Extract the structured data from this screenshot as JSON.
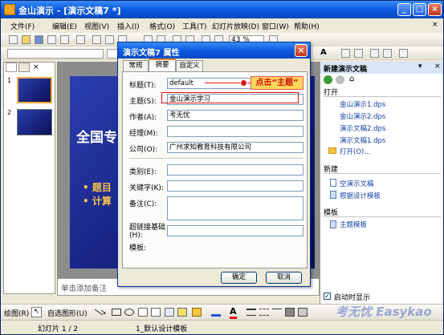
{
  "window": {
    "title": "金山演示 - [演示文稿7 *]",
    "min": "_",
    "max": "□",
    "close": "×"
  },
  "menu": [
    "文件(F)",
    "编辑(E)",
    "视图(V)",
    "插入(I)",
    "格式(O)",
    "工具(T)",
    "幻灯片放映(D)",
    "窗口(W)",
    "帮助(H)"
  ],
  "menu_extra": "×",
  "toolbar": {
    "zoom": "43 %"
  },
  "slide_pane": {
    "thumb_numbers": [
      "1",
      "2"
    ],
    "notes_placeholder": "单击添加备注"
  },
  "slide": {
    "title_partial": "全国专",
    "bullets": [
      "• 题目",
      "• 计算"
    ]
  },
  "dialog": {
    "title": "演示文稿7 属性",
    "tabs": [
      "常规",
      "摘要",
      "自定义"
    ],
    "active_tab": "摘要",
    "fields": {
      "title_label": "标题(T):",
      "title_value": "default",
      "subject_label": "主题(S):",
      "subject_value": "金山演示学习",
      "author_label": "作者(A):",
      "author_value": "考无忧",
      "manager_label": "经理(M):",
      "manager_value": "",
      "company_label": "公司(O):",
      "company_value": "广州求知教育科技有限公司",
      "category_label": "类别(E):",
      "category_value": "",
      "keywords_label": "关键字(K):",
      "keywords_value": "",
      "comments_label": "备注(C):",
      "comments_value": "",
      "hyperlink_label": "超链接基础(H):",
      "hyperlink_value": "",
      "template_label": "模板:"
    },
    "ok": "确定",
    "cancel": "取消"
  },
  "callout": "点击“主题”",
  "taskpane": {
    "title": "新建演示文稿",
    "open_header": "打开",
    "recent_files": [
      "金山演示1.dps",
      "金山演示2.dps",
      "演示文稿2.dps",
      "演示文稿1.dps"
    ],
    "open_more": "打开(O)...",
    "new_header": "新建",
    "new_items": [
      "空演示文稿",
      "根据设计模板"
    ],
    "template_header": "模板",
    "template_items": [
      "主题模板"
    ],
    "show_on_startup": "启动时显示"
  },
  "drawbar": {
    "draw": "绘图(R)",
    "autoshape": "自选图形(U)"
  },
  "status": {
    "slide": "幻灯片 1 / 2",
    "template": "1_默认设计模板"
  },
  "watermark": "考无忧 Easykao"
}
